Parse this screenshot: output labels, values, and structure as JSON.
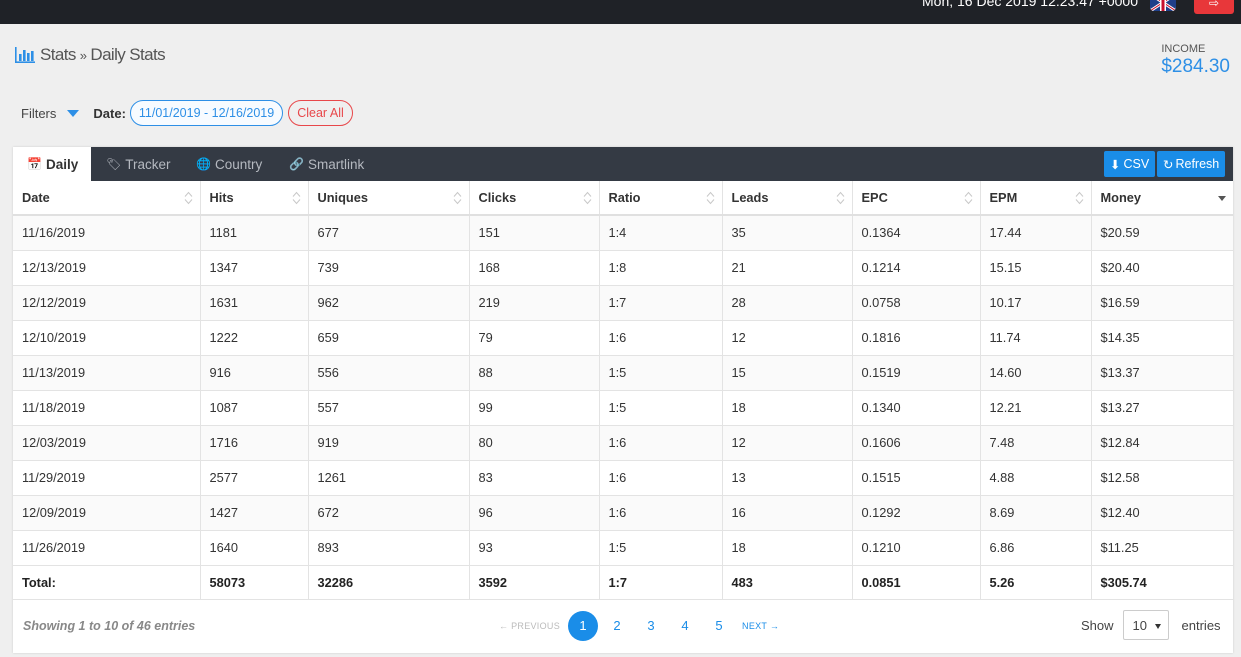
{
  "topbar": {
    "datetime": "Mon, 16 Dec 2019 12:23:47 +0000",
    "flag_icon": "uk-flag-icon",
    "logout_icon": "logout-icon",
    "logout_color": "#e8373a"
  },
  "breadcrumb": {
    "icon": "bar-chart-icon",
    "root": "Stats",
    "separator": "»",
    "current": "Daily Stats"
  },
  "income": {
    "label": "INCOME",
    "value": "$284.30"
  },
  "filters": {
    "label": "Filters",
    "date_label": "Date:",
    "date_range": "11/01/2019 - 12/16/2019",
    "clear_label": "Clear All"
  },
  "tabs": [
    {
      "label": "Daily",
      "icon": "calendar-icon",
      "active": true
    },
    {
      "label": "Tracker",
      "icon": "tag-icon",
      "active": false
    },
    {
      "label": "Country",
      "icon": "globe-icon",
      "active": false
    },
    {
      "label": "Smartlink",
      "icon": "link-icon",
      "active": false
    }
  ],
  "toolbar": {
    "csv_label": "CSV",
    "refresh_label": "Refresh",
    "accent": "#1a8de8"
  },
  "table": {
    "columns": [
      "Date",
      "Hits",
      "Uniques",
      "Clicks",
      "Ratio",
      "Leads",
      "EPC",
      "EPM",
      "Money"
    ],
    "sorted_column": "Money",
    "rows": [
      [
        "11/16/2019",
        "1181",
        "677",
        "151",
        "1:4",
        "35",
        "0.1364",
        "17.44",
        "$20.59"
      ],
      [
        "12/13/2019",
        "1347",
        "739",
        "168",
        "1:8",
        "21",
        "0.1214",
        "15.15",
        "$20.40"
      ],
      [
        "12/12/2019",
        "1631",
        "962",
        "219",
        "1:7",
        "28",
        "0.0758",
        "10.17",
        "$16.59"
      ],
      [
        "12/10/2019",
        "1222",
        "659",
        "79",
        "1:6",
        "12",
        "0.1816",
        "11.74",
        "$14.35"
      ],
      [
        "11/13/2019",
        "916",
        "556",
        "88",
        "1:5",
        "15",
        "0.1519",
        "14.60",
        "$13.37"
      ],
      [
        "11/18/2019",
        "1087",
        "557",
        "99",
        "1:5",
        "18",
        "0.1340",
        "12.21",
        "$13.27"
      ],
      [
        "12/03/2019",
        "1716",
        "919",
        "80",
        "1:6",
        "12",
        "0.1606",
        "7.48",
        "$12.84"
      ],
      [
        "11/29/2019",
        "2577",
        "1261",
        "83",
        "1:6",
        "13",
        "0.1515",
        "4.88",
        "$12.58"
      ],
      [
        "12/09/2019",
        "1427",
        "672",
        "96",
        "1:6",
        "16",
        "0.1292",
        "8.69",
        "$12.40"
      ],
      [
        "11/26/2019",
        "1640",
        "893",
        "93",
        "1:5",
        "18",
        "0.1210",
        "6.86",
        "$11.25"
      ]
    ],
    "total": [
      "Total:",
      "58073",
      "32286",
      "3592",
      "1:7",
      "483",
      "0.0851",
      "5.26",
      "$305.74"
    ]
  },
  "footer": {
    "info": "Showing 1 to 10 of 46 entries",
    "previous": "← PREVIOUS",
    "next": "NEXT →",
    "pages": [
      "1",
      "2",
      "3",
      "4",
      "5"
    ],
    "current_page": "1",
    "show_label": "Show",
    "page_size": "10",
    "entries_label": "entries"
  }
}
